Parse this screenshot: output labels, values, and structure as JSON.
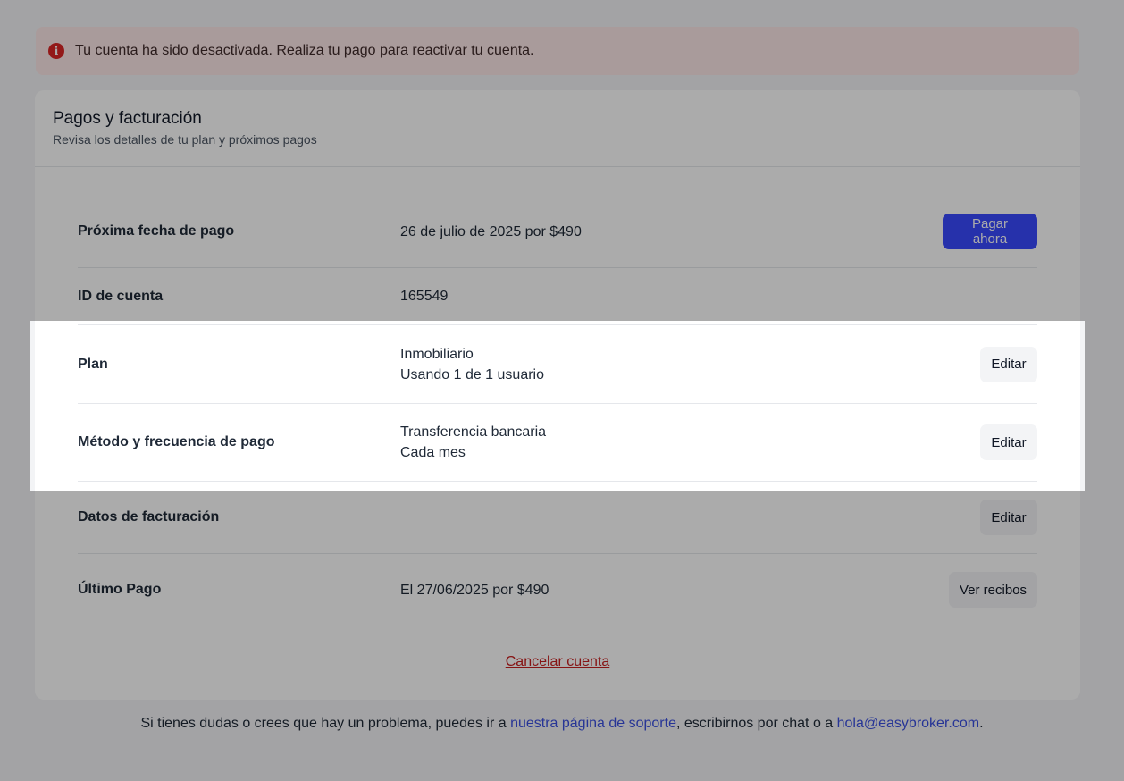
{
  "alert": {
    "icon": "info-circle-icon",
    "message": "Tu cuenta ha sido desactivada. Realiza tu pago para reactivar tu cuenta."
  },
  "card": {
    "title": "Pagos y facturación",
    "subtitle": "Revisa los detalles de tu plan y próximos pagos"
  },
  "rows": {
    "next_payment": {
      "label": "Próxima fecha de pago",
      "value": "26 de julio de 2025 por $490",
      "action": "Pagar ahora"
    },
    "account_id": {
      "label": "ID de cuenta",
      "value": "165549"
    },
    "plan": {
      "label": "Plan",
      "value_line1": "Inmobiliario",
      "value_line2": "Usando 1 de 1 usuario",
      "action": "Editar"
    },
    "payment_method": {
      "label": "Método y frecuencia de pago",
      "value_line1": "Transferencia bancaria",
      "value_line2": "Cada mes",
      "action": "Editar"
    },
    "billing_data": {
      "label": "Datos de facturación",
      "action": "Editar"
    },
    "last_payment": {
      "label": "Último Pago",
      "value": "El 27/06/2025 por $490",
      "action": "Ver recibos"
    }
  },
  "cancel_link": "Cancelar cuenta",
  "footer": {
    "text_before": "Si tienes dudas o crees que hay un problema, puedes ir a ",
    "support_link": "nuestra página de soporte",
    "text_middle": ", escribirnos por chat o a ",
    "email_link": "hola@easybroker.com",
    "text_after": "."
  },
  "colors": {
    "primary": "#3a49ff",
    "danger": "#c81e1e",
    "alert_bg": "#fde8e8",
    "link": "#3b4fe0"
  }
}
